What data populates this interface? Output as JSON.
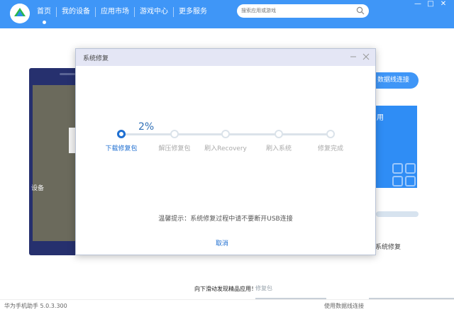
{
  "nav": {
    "items": [
      "首页",
      "我的设备",
      "应用市场",
      "游戏中心",
      "更多服务"
    ]
  },
  "search": {
    "placeholder": "搜索应用或游戏"
  },
  "window_controls": [
    "—",
    "□",
    "✕"
  ],
  "background": {
    "device_status": "设备",
    "connect_button": "数据线连接",
    "panel_label": "用",
    "system_repair_label": "系统修复",
    "explore_text": "向下滑动发现精品应用！",
    "explore_sub": "修复包",
    "cable_label": "使用数据线连接"
  },
  "status_bar": {
    "version": "华为手机助手 5.0.3.300"
  },
  "dialog": {
    "title": "系统修复",
    "percent": "2%",
    "progress": 0.02,
    "steps": [
      "下载修复包",
      "解压修复包",
      "刷入Recovery",
      "刷入系统",
      "修复完成"
    ],
    "active_step": 0,
    "tip": "温馨提示：系统修复过程中请不要断开USB连接",
    "cancel_label": "取消"
  },
  "colors": {
    "brand_blue": "#3f96f7",
    "active_step": "#1f6fd1",
    "dialog_header": "#e4e6f5"
  }
}
